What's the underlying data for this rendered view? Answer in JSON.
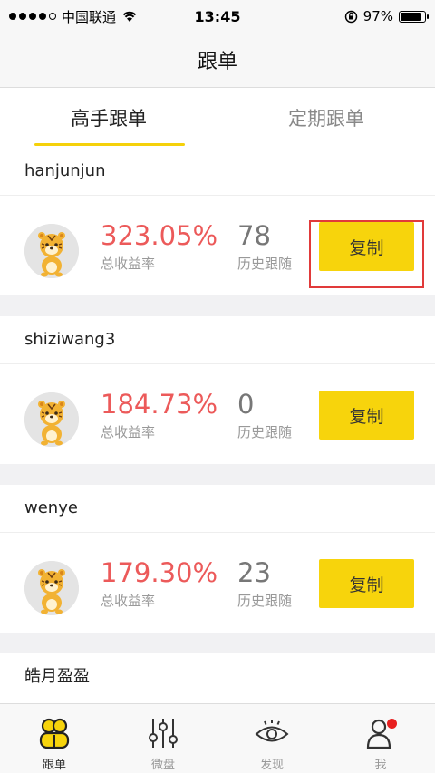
{
  "status": {
    "carrier": "中国联通",
    "time": "13:45",
    "battery": "97%",
    "battery_level": 0.97
  },
  "nav": {
    "title": "跟单"
  },
  "tabs": [
    {
      "label": "高手跟单",
      "active": true
    },
    {
      "label": "定期跟单",
      "active": false
    }
  ],
  "traders": [
    {
      "name": "hanjunjun",
      "return_pct": "323.05%",
      "return_label": "总收益率",
      "followers": "78",
      "followers_label": "历史跟随",
      "button": "复制"
    },
    {
      "name": "shiziwang3",
      "return_pct": "184.73%",
      "return_label": "总收益率",
      "followers": "0",
      "followers_label": "历史跟随",
      "button": "复制"
    },
    {
      "name": "wenye",
      "return_pct": "179.30%",
      "return_label": "总收益率",
      "followers": "23",
      "followers_label": "历史跟随",
      "button": "复制"
    },
    {
      "name": "皓月盈盈"
    }
  ],
  "tabbar": [
    {
      "label": "跟单",
      "icon": "people-icon",
      "active": true
    },
    {
      "label": "微盘",
      "icon": "sliders-icon",
      "active": false
    },
    {
      "label": "发现",
      "icon": "eye-icon",
      "active": false
    },
    {
      "label": "我",
      "icon": "user-icon",
      "active": false,
      "badge": true
    }
  ],
  "colors": {
    "accent": "#f7d40c",
    "profit": "#ec5a5a",
    "highlight": "#e13a3a",
    "badge": "#e82020"
  }
}
